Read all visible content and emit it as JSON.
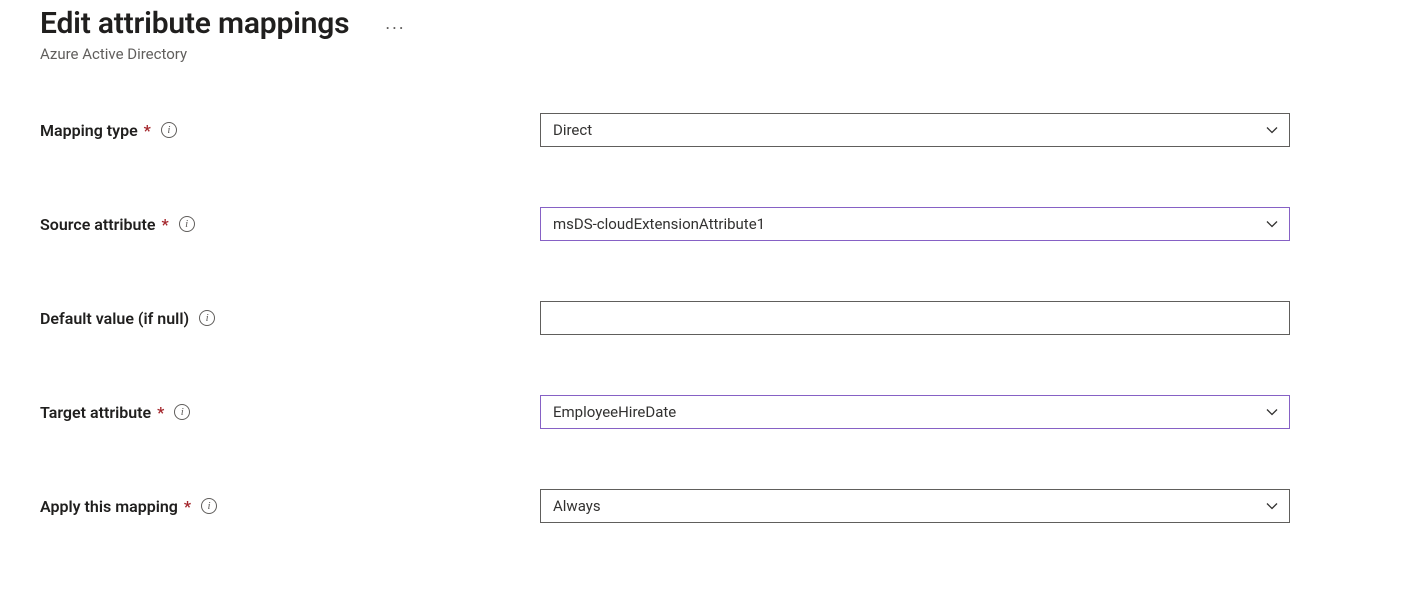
{
  "header": {
    "title": "Edit attribute mappings",
    "subtitle": "Azure Active Directory",
    "menu_label": "..."
  },
  "info_glyph": "i",
  "fields": {
    "mapping_type": {
      "label": "Mapping type",
      "required": true,
      "value": "Direct"
    },
    "source_attr": {
      "label": "Source attribute",
      "required": true,
      "value": "msDS-cloudExtensionAttribute1"
    },
    "default_value": {
      "label": "Default value (if null)",
      "required": false,
      "value": ""
    },
    "target_attr": {
      "label": "Target attribute",
      "required": true,
      "value": "EmployeeHireDate"
    },
    "apply_mapping": {
      "label": "Apply this mapping",
      "required": true,
      "value": "Always"
    }
  }
}
